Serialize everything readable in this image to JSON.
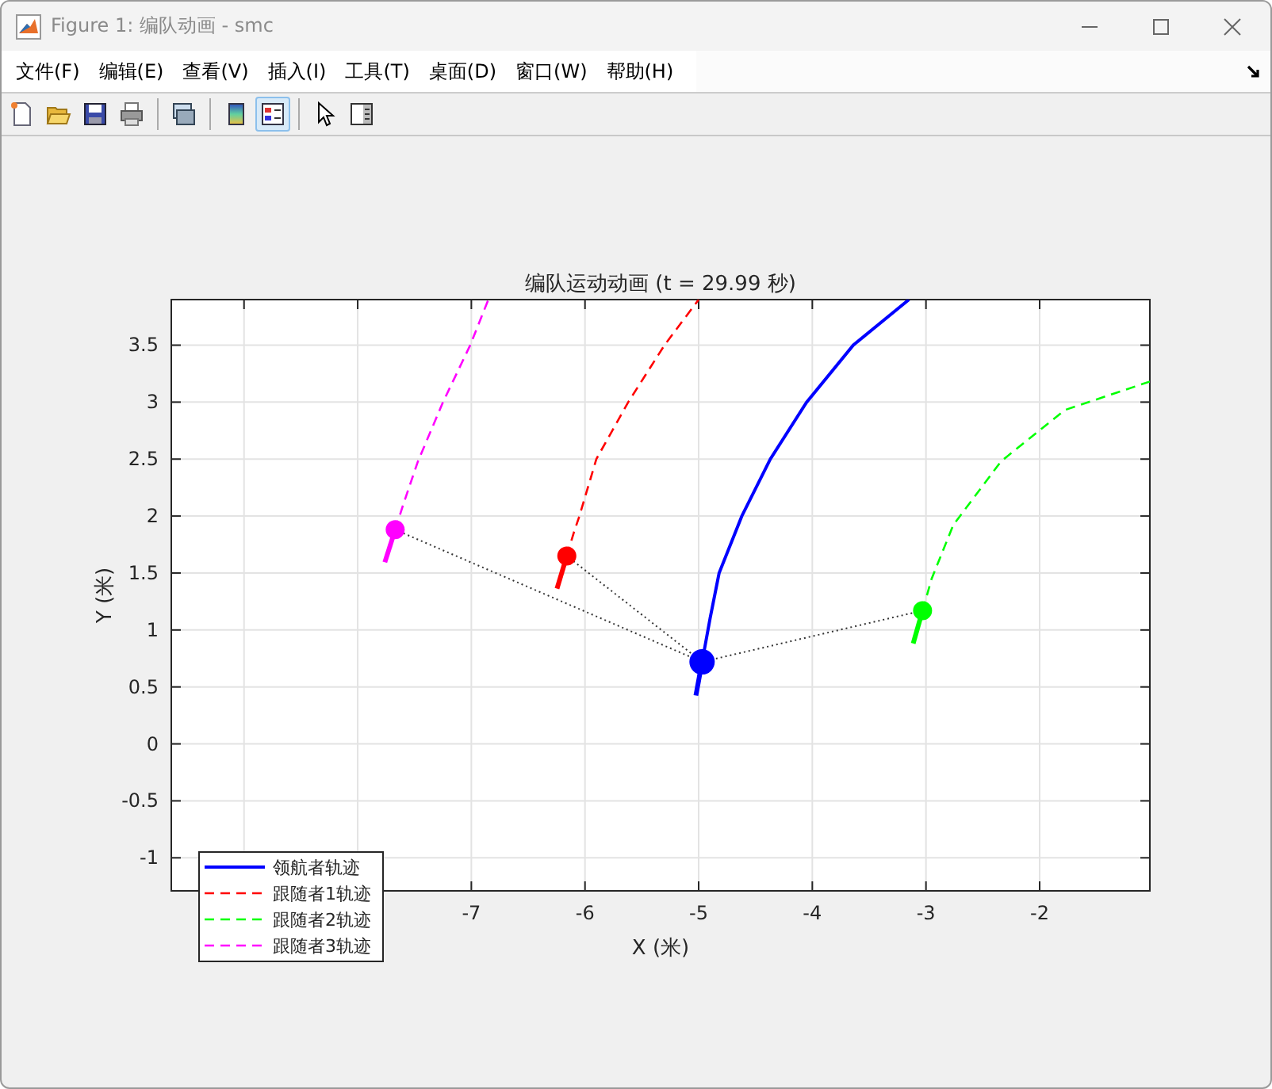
{
  "window": {
    "title": "Figure 1: 编队动画 - smc"
  },
  "menu": [
    "文件(F)",
    "编辑(E)",
    "查看(V)",
    "插入(I)",
    "工具(T)",
    "桌面(D)",
    "窗口(W)",
    "帮助(H)"
  ],
  "toolbar": [
    {
      "kind": "new",
      "selected": false
    },
    {
      "kind": "open",
      "selected": false
    },
    {
      "kind": "save",
      "selected": false
    },
    {
      "kind": "print",
      "selected": false
    },
    {
      "kind": "sep"
    },
    {
      "kind": "link",
      "selected": false
    },
    {
      "kind": "sep"
    },
    {
      "kind": "colorbar",
      "selected": false
    },
    {
      "kind": "legend",
      "selected": true
    },
    {
      "kind": "sep"
    },
    {
      "kind": "pointer",
      "selected": false
    },
    {
      "kind": "panel",
      "selected": false
    }
  ],
  "chart_data": {
    "type": "line",
    "title": "编队运动动画 (t = 29.99 秒)",
    "xlabel": "X (米)",
    "ylabel": "Y (米)",
    "xlim": [
      -9.64,
      -1.03
    ],
    "ylim": [
      -1.29,
      3.9
    ],
    "xticks": [
      -7,
      -6,
      -5,
      -4,
      -3,
      -2
    ],
    "yticks": [
      -1,
      -0.5,
      0,
      0.5,
      1,
      1.5,
      2,
      2.5,
      3,
      3.5
    ],
    "grid": true,
    "legend": "lower left",
    "series": [
      {
        "name": "领航者轨迹",
        "line_style": "solid",
        "color": "#0000ff",
        "x": [
          -4.97,
          -4.9,
          -4.82,
          -4.62,
          -4.37,
          -4.05,
          -3.64,
          -3.15
        ],
        "values": [
          0.72,
          1.1,
          1.5,
          2,
          2.5,
          3,
          3.5,
          3.9
        ]
      },
      {
        "name": "跟随者1轨迹",
        "line_style": "dashed",
        "color": "#ff0000",
        "x": [
          -6.16,
          -6.1,
          -6.05,
          -5.9,
          -5.62,
          -5.3,
          -5.0
        ],
        "values": [
          1.65,
          1.85,
          2,
          2.5,
          3,
          3.5,
          3.9
        ]
      },
      {
        "name": "跟随者2轨迹",
        "line_style": "dashed",
        "color": "#00ff00",
        "x": [
          -3.03,
          -2.95,
          -2.76,
          -2.34,
          -1.78,
          -1.03
        ],
        "values": [
          1.17,
          1.45,
          1.92,
          2.48,
          2.93,
          3.18
        ]
      },
      {
        "name": "跟随者3轨迹",
        "line_style": "dashed",
        "color": "#ff00ff",
        "x": [
          -7.67,
          -7.6,
          -7.47,
          -7.25,
          -7.01,
          -6.85
        ],
        "values": [
          1.88,
          2.1,
          2.48,
          3,
          3.5,
          3.9
        ]
      }
    ]
  }
}
